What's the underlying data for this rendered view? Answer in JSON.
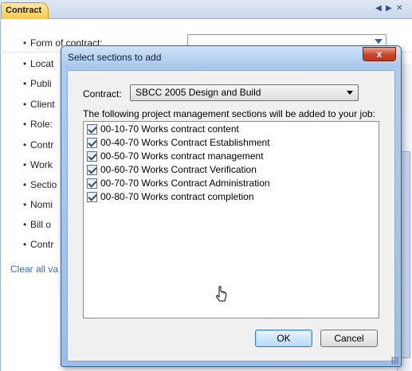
{
  "panel": {
    "tab_label": "Contract",
    "fields": [
      "Form of contract:",
      "Locat",
      "Publi",
      "Client",
      "Role:",
      "Contr",
      "Work",
      "Sectio",
      "Nomi",
      "Bill o",
      "Contr"
    ],
    "clear_link": "Clear all va"
  },
  "dialog": {
    "title": "Select sections to add",
    "close_label": "x",
    "contract_label": "Contract:",
    "contract_value": "SBCC 2005 Design and Build",
    "info_text": "The following project management sections will be added to your job:",
    "sections": [
      "00-10-70 Works contract content",
      "00-40-70 Works Contract Establishment",
      "00-50-70 Works contract management",
      "00-60-70 Works Contract Verification",
      "00-70-70 Works Contract Administration",
      "00-80-70 Works contract completion"
    ],
    "ok_label": "OK",
    "cancel_label": "Cancel"
  },
  "colors": {
    "tab_accent": "#f6c64a",
    "titlebar": "#a7c6ec",
    "close_button": "#c8452b",
    "link": "#3a6dc2"
  },
  "icons": [
    "dropdown-arrow-icon",
    "close-icon",
    "checkbox-checked-icon",
    "cursor-icon",
    "resize-grip-icon"
  ]
}
